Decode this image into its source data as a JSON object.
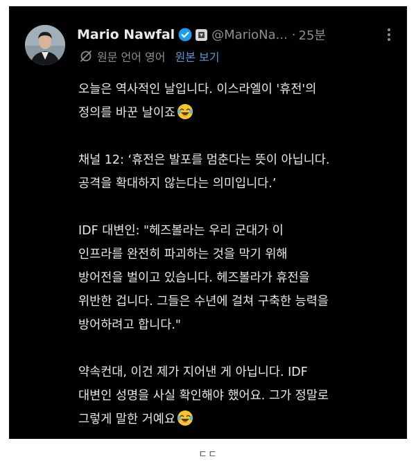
{
  "post": {
    "author_name": "Mario Nawfal",
    "handle": "@MarioNa...",
    "separator": "·",
    "time": "25분",
    "translation_note": "원문 언어 영어",
    "show_original_label": "원본 보기",
    "paragraphs": [
      {
        "lines": [
          "오늘은 역사적인 날입니다. 이스라엘이 '휴전'의",
          "정의를 바꾼 날이죠"
        ],
        "emoji": "laughing-tears-emoji"
      },
      {
        "lines": [
          "채널 12: ‘휴전은 발포를 멈춘다는 뜻이 아닙니다.",
          "공격을 확대하지 않는다는 의미입니다.’"
        ]
      },
      {
        "lines": [
          "IDF 대변인: \"헤즈볼라는 우리 군대가 이",
          "인프라를 완전히 파괴하는 것을 막기 위해",
          "방어전을 벌이고 있습니다. 헤즈볼라가 휴전을",
          "위반한 겁니다. 그들은 수년에 걸쳐 구축한 능력을",
          "방어하려고 합니다.\""
        ]
      },
      {
        "lines": [
          "약속컨대, 이건 제가 지어낸 게 아닙니다. IDF",
          "대변인 성명을 사실 확인해야 했어요. 그가 정말로",
          "그렇게 말한 거예요"
        ],
        "emoji": "laughing-tears-emoji"
      }
    ]
  },
  "caption": "ㄷㄷ",
  "colors": {
    "background": "#000000",
    "text": "#e9e9e9",
    "muted": "#8b8f94",
    "link": "#5b9bd5",
    "verified": "#1d9bf0"
  }
}
